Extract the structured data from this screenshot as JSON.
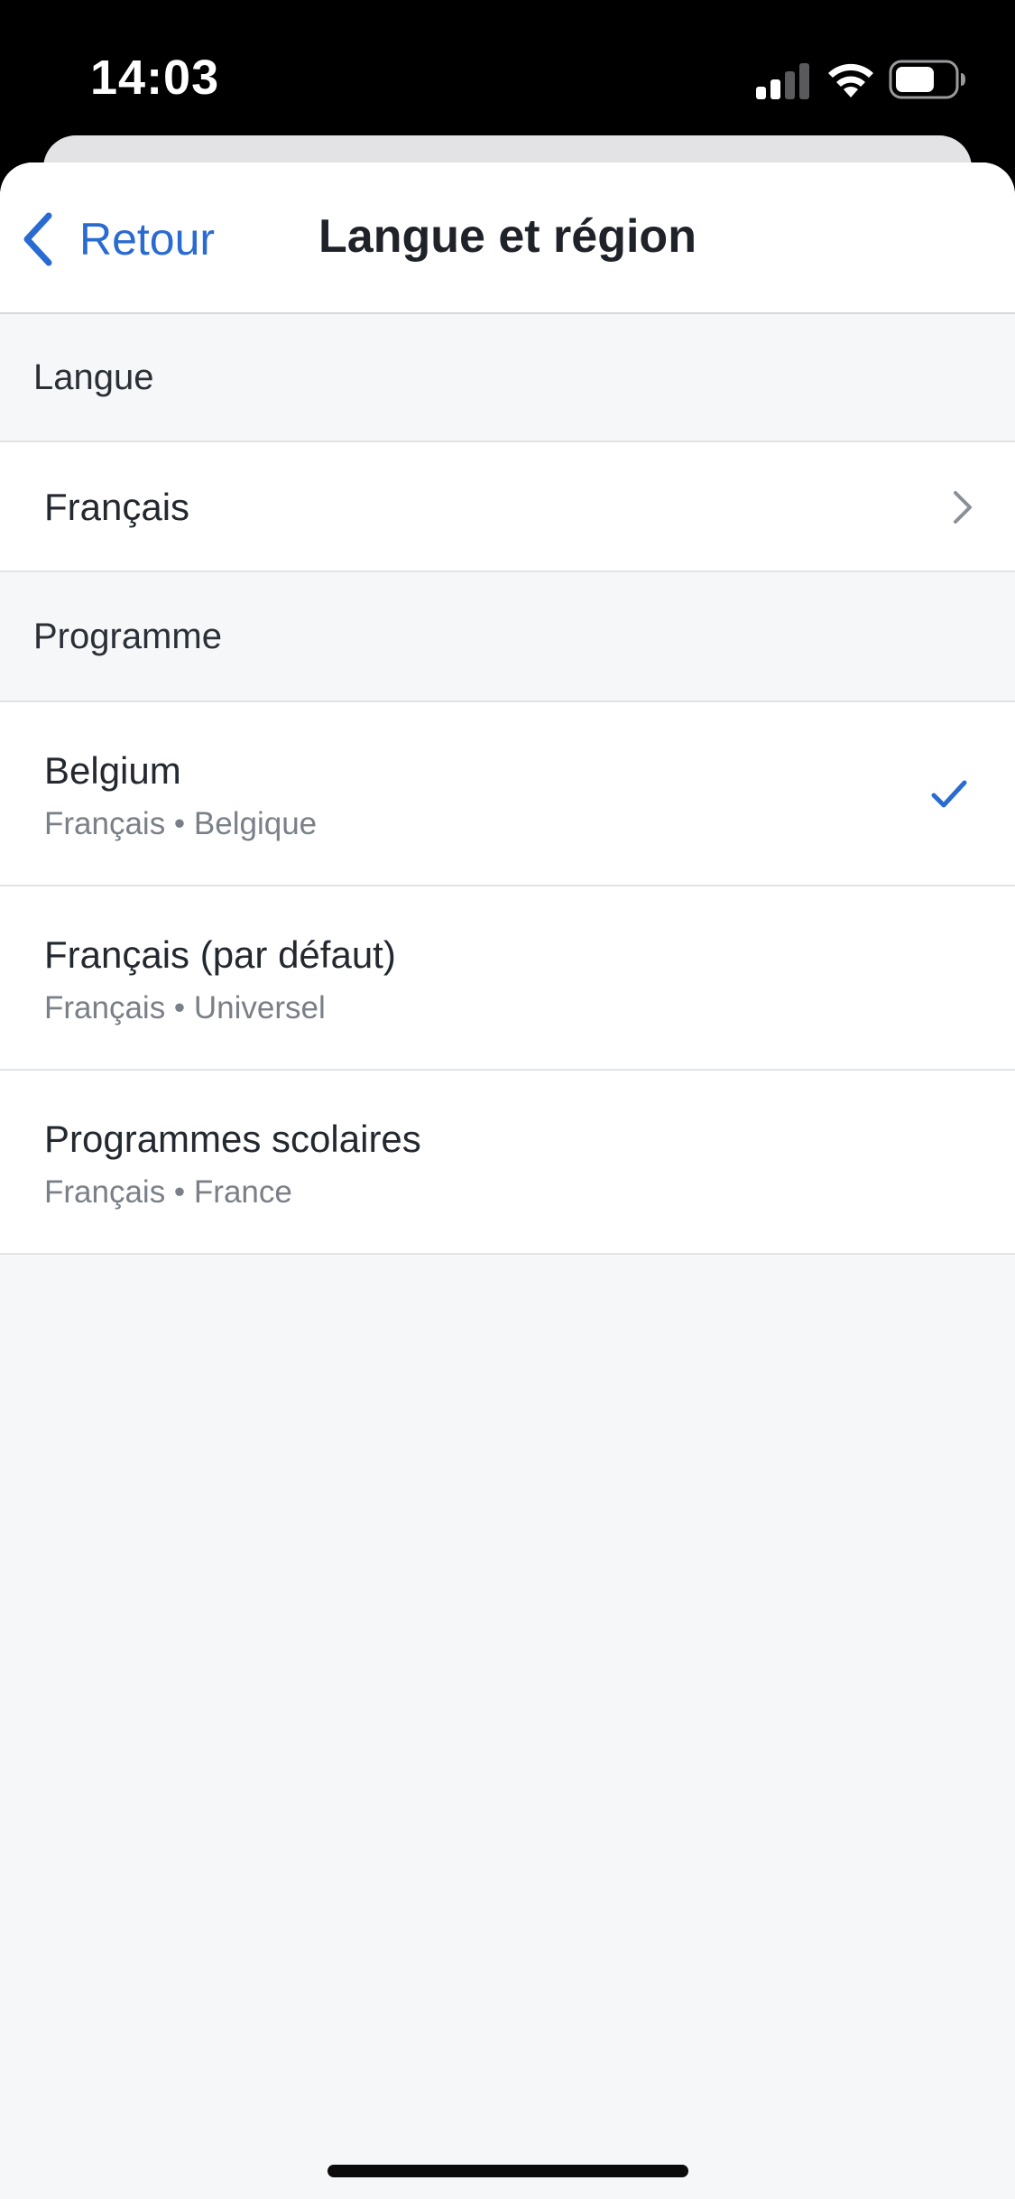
{
  "status_bar": {
    "time": "14:03",
    "icons": [
      "signal-icon",
      "wifi-icon",
      "battery-icon"
    ]
  },
  "nav": {
    "back_label": "Retour",
    "title": "Langue et région"
  },
  "language_section": {
    "header": "Langue",
    "selected_language": "Français"
  },
  "program_section": {
    "header": "Programme",
    "items": [
      {
        "title": "Belgium",
        "subtitle": "Français • Belgique",
        "selected": true
      },
      {
        "title": "Français (par défaut)",
        "subtitle": "Français • Universel",
        "selected": false
      },
      {
        "title": "Programmes scolaires",
        "subtitle": "Français • France",
        "selected": false
      }
    ]
  },
  "colors": {
    "accent": "#2a6bd1",
    "background": "#f6f7f9",
    "row_background": "#ffffff",
    "secondary_text": "#7a7f88"
  }
}
